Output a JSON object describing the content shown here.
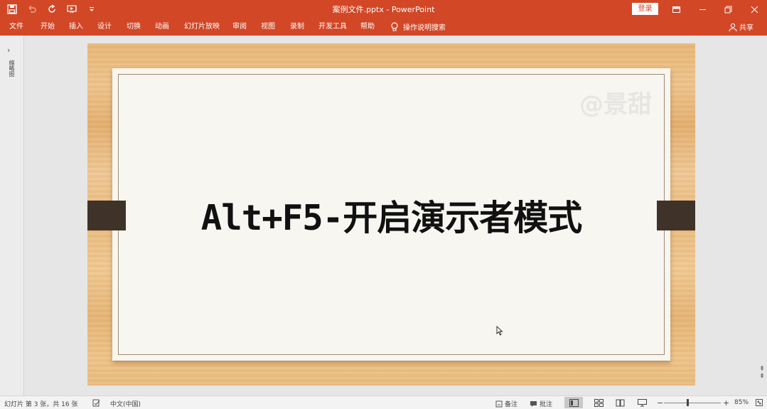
{
  "window": {
    "title": "案例文件.pptx  -  PowerPoint",
    "login_label": "登录"
  },
  "ribbon": {
    "tabs": [
      "文件",
      "开始",
      "插入",
      "设计",
      "切换",
      "动画",
      "幻灯片放映",
      "审阅",
      "视图",
      "录制",
      "开发工具",
      "帮助"
    ],
    "tell_me": "操作说明搜索",
    "share": "共享"
  },
  "thumbnails": {
    "panel_label": "缩略图"
  },
  "slide": {
    "headline": "Alt+F5-开启演示者模式",
    "watermark": "@景甜"
  },
  "statusbar": {
    "slide_info": "幻灯片 第 3 张，共 16 张",
    "language": "中文(中国)",
    "notes_label": "备注",
    "comments_label": "批注",
    "zoom_percent": "85%",
    "zoom_value": 85
  },
  "colors": {
    "accent": "#d24726",
    "slide_bg": "#e9bb7e",
    "paper": "#f7f6f1",
    "side_tabs": "#3e3229"
  }
}
